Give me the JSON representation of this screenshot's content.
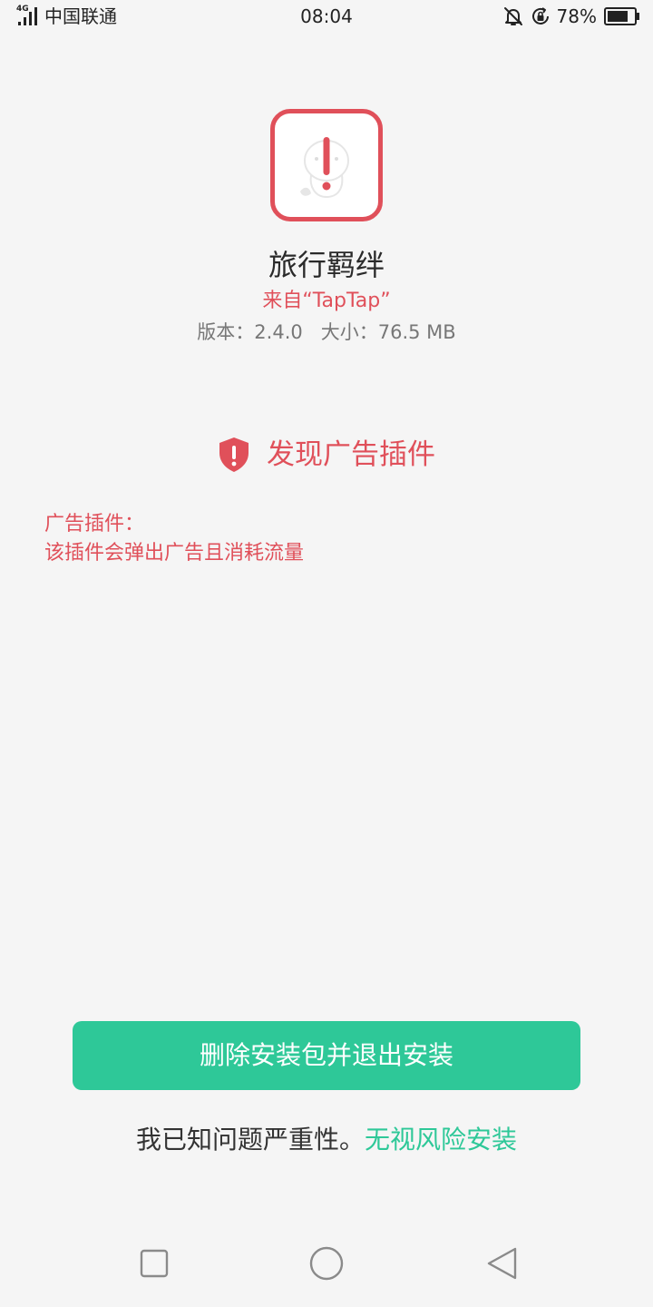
{
  "status_bar": {
    "network_type": "4G",
    "carrier": "中国联通",
    "time": "08:04",
    "battery_percent": "78%",
    "icons": [
      "signal-icon",
      "mute-bell-icon",
      "rotation-lock-icon",
      "battery-icon"
    ]
  },
  "app": {
    "icon": "app-warning-icon",
    "name": "旅行羁绊",
    "source": "来自“TapTap”",
    "version": "版本：2.4.0",
    "size": "大小：76.5 MB"
  },
  "warning": {
    "icon": "shield-alert-icon",
    "title": "发现广告插件",
    "plugin_label": "广告插件：",
    "plugin_description": "该插件会弹出广告且消耗流量"
  },
  "actions": {
    "delete_button_label": "删除安装包并退出安装",
    "notice_text": "我已知问题严重性。",
    "ignore_link_label": "无视风险安装"
  },
  "nav_bar": {
    "icons": [
      "recent-apps-icon",
      "home-icon",
      "back-icon"
    ]
  },
  "colors": {
    "danger": "#e0505a",
    "accent": "#2ec898",
    "background": "#f5f5f5"
  }
}
